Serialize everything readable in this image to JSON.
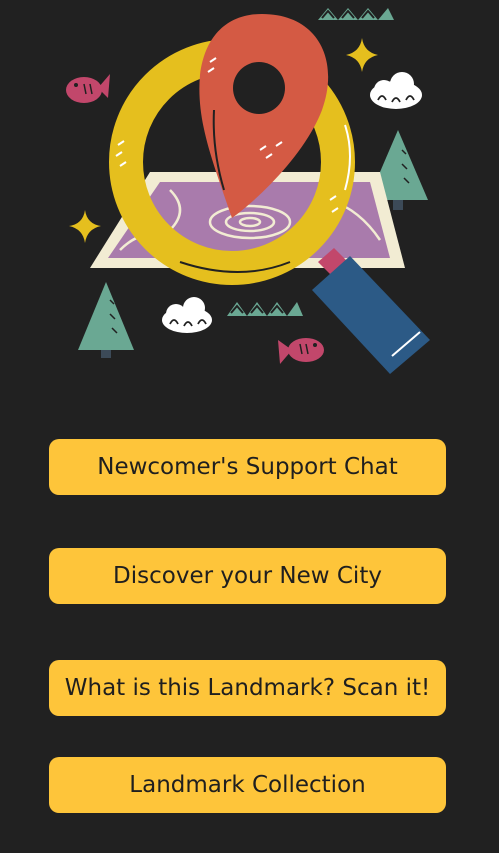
{
  "colors": {
    "background": "#212121",
    "button": "#fec53a",
    "button_text": "#1f1f1f",
    "pin": "#d45a44",
    "ring": "#e5bf1e",
    "handle": "#2c5a86",
    "map": "#f2ecd3",
    "map_land": "#a97bac",
    "tree": "#6aa893",
    "fish": "#c2476b"
  },
  "illustration": {
    "icon": "location-pin-magnifier-map-icon"
  },
  "menu": {
    "support_chat": "Newcomer's Support Chat",
    "discover_city": "Discover your New City",
    "scan_landmark": "What is this Landmark? Scan it!",
    "landmark_collection": "Landmark Collection"
  }
}
